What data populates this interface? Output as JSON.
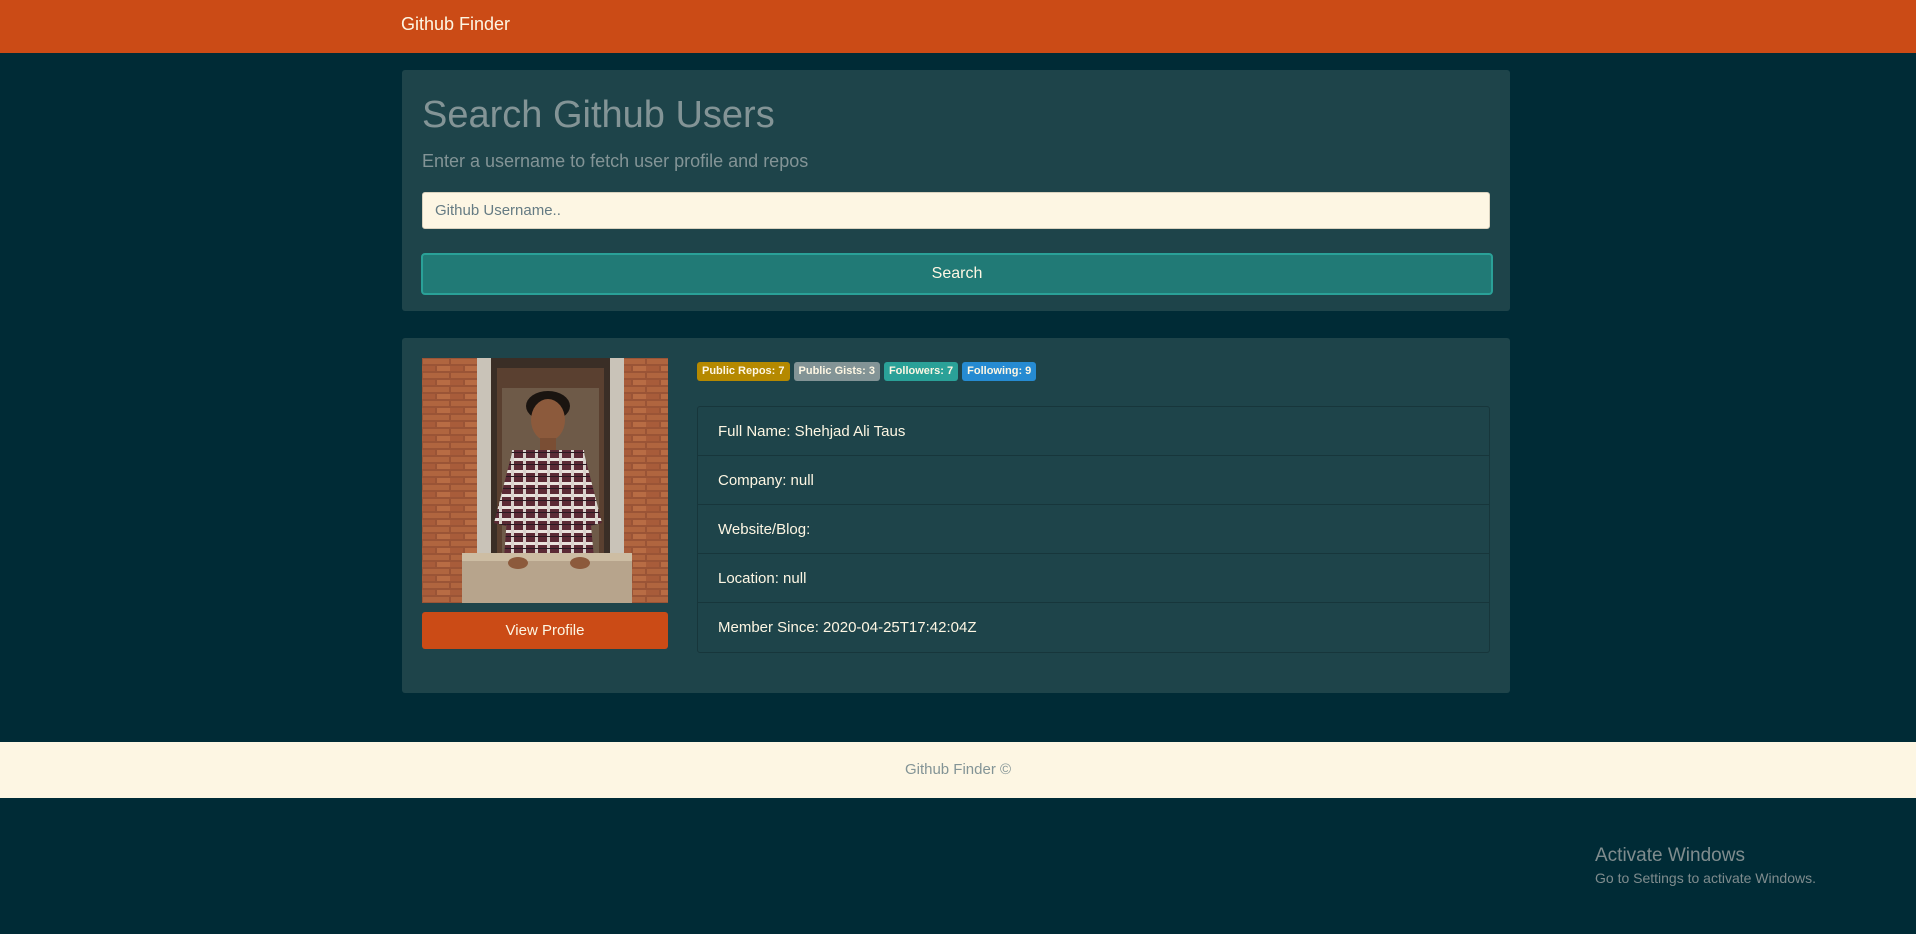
{
  "navbar": {
    "brand": "Github Finder"
  },
  "search": {
    "title": "Search Github Users",
    "subtitle": "Enter a username to fetch user profile and repos",
    "placeholder": "Github Username..",
    "button_label": "Search"
  },
  "profile": {
    "view_profile_label": "View Profile",
    "badges": [
      {
        "label": "Public Repos: 7",
        "color": "#b58900"
      },
      {
        "label": "Public Gists: 3",
        "color": "#839496"
      },
      {
        "label": "Followers: 7",
        "color": "#2aa198"
      },
      {
        "label": "Following: 9",
        "color": "#268bd2"
      }
    ],
    "details": [
      "Full Name: Shehjad Ali Taus",
      "Company: null",
      "Website/Blog:",
      "Location: null",
      "Member Since: 2020-04-25T17:42:04Z"
    ]
  },
  "footer": {
    "text": "Github Finder ©"
  },
  "watermark": {
    "title": "Activate Windows",
    "subtitle": "Go to Settings to activate Windows."
  },
  "colors": {
    "navbar": "#cb4b16",
    "background": "#002b36",
    "card": "#1e444a",
    "search_button": "#217a76",
    "footer": "#fdf6e3"
  }
}
